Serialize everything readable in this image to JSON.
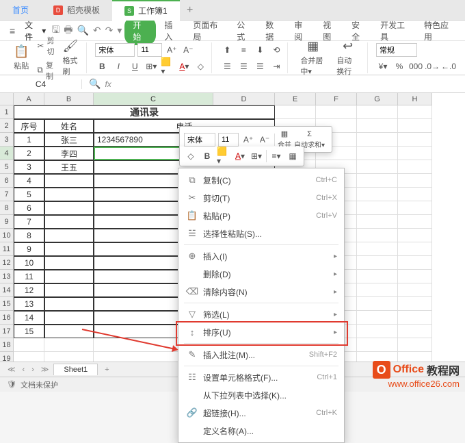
{
  "tabs": {
    "home": "首页",
    "template": "稻壳模板",
    "active": "工作簿1"
  },
  "menu": {
    "file": "文件",
    "start": "开始",
    "items": [
      "插入",
      "页面布局",
      "公式",
      "数据",
      "审阅",
      "视图",
      "安全",
      "开发工具",
      "特色应用"
    ]
  },
  "ribbon": {
    "paste": "粘贴",
    "cut": "剪切",
    "copy": "复制",
    "format_brush": "格式刷",
    "font_name": "宋体",
    "font_size": "11",
    "merge": "合并居中",
    "wrap": "自动换行",
    "number_format": "常规"
  },
  "namebox": "C4",
  "fx_label": "fx",
  "columns": [
    "A",
    "B",
    "C",
    "D",
    "E",
    "F",
    "G",
    "H"
  ],
  "row_numbers": [
    "1",
    "2",
    "3",
    "4",
    "5",
    "6",
    "7",
    "8",
    "9",
    "10",
    "11",
    "12",
    "13",
    "14",
    "15",
    "16",
    "17",
    "18",
    "19"
  ],
  "sheet": {
    "title": "通讯录",
    "headers": [
      "序号",
      "姓名",
      "电话"
    ],
    "rows": [
      {
        "no": "1",
        "name": "张三",
        "phone": "1234567890"
      },
      {
        "no": "2",
        "name": "李四",
        "phone": ""
      },
      {
        "no": "3",
        "name": "王五",
        "phone": ""
      },
      {
        "no": "4",
        "name": "",
        "phone": ""
      },
      {
        "no": "5",
        "name": "",
        "phone": ""
      },
      {
        "no": "6",
        "name": "",
        "phone": ""
      },
      {
        "no": "7",
        "name": "",
        "phone": ""
      },
      {
        "no": "8",
        "name": "",
        "phone": ""
      },
      {
        "no": "9",
        "name": "",
        "phone": ""
      },
      {
        "no": "10",
        "name": "",
        "phone": ""
      },
      {
        "no": "11",
        "name": "",
        "phone": ""
      },
      {
        "no": "12",
        "name": "",
        "phone": ""
      },
      {
        "no": "13",
        "name": "",
        "phone": ""
      },
      {
        "no": "14",
        "name": "",
        "phone": ""
      },
      {
        "no": "15",
        "name": "",
        "phone": ""
      }
    ]
  },
  "mini": {
    "font": "宋体",
    "size": "11",
    "merge": "合并",
    "sum": "自动求和"
  },
  "context": {
    "copy": "复制(C)",
    "copy_sc": "Ctrl+C",
    "cut": "剪切(T)",
    "cut_sc": "Ctrl+X",
    "paste": "粘贴(P)",
    "paste_sc": "Ctrl+V",
    "paste_special": "选择性粘贴(S)...",
    "insert": "插入(I)",
    "delete": "删除(D)",
    "clear": "清除内容(N)",
    "filter": "筛选(L)",
    "sort": "排序(U)",
    "comment": "插入批注(M)...",
    "comment_sc": "Shift+F2",
    "format_cells": "设置单元格格式(F)...",
    "format_cells_sc": "Ctrl+1",
    "dropdown": "从下拉列表中选择(K)...",
    "hyperlink": "超链接(H)...",
    "hyperlink_sc": "Ctrl+K",
    "define_name": "定义名称(A)..."
  },
  "sheet_tab": "Sheet1",
  "status": "文档未保护",
  "watermark": {
    "brand1": "Office",
    "brand2": "教程网",
    "url": "www.office26.com"
  }
}
